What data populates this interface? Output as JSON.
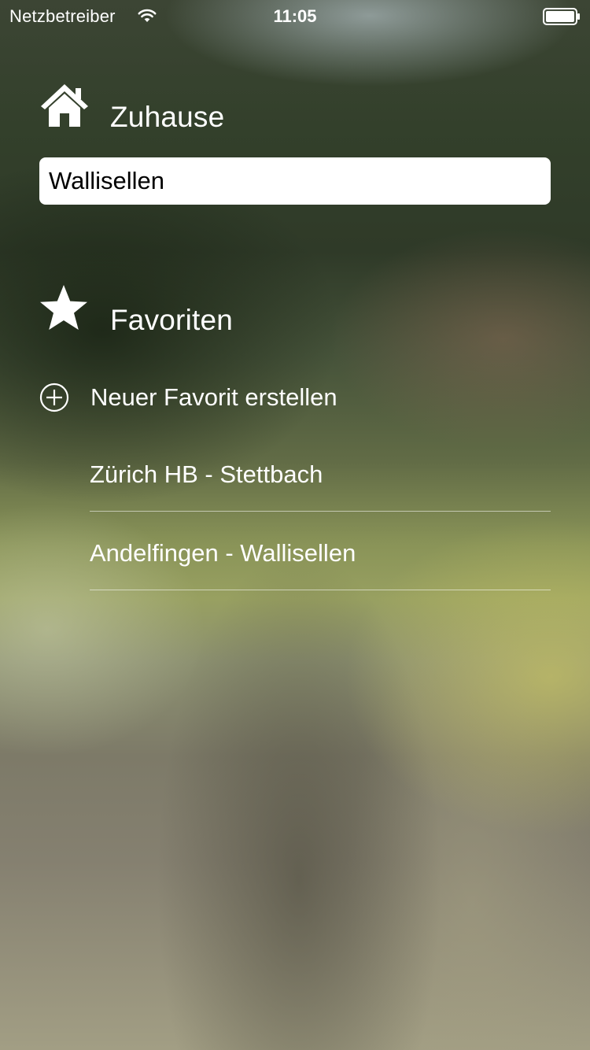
{
  "status_bar": {
    "carrier": "Netzbetreiber",
    "time": "11:05",
    "wifi_icon": "wifi-icon",
    "battery_icon": "battery-icon"
  },
  "home": {
    "icon": "house-icon",
    "title": "Zuhause",
    "field_value": "Wallisellen"
  },
  "favorites": {
    "icon": "star-icon",
    "title": "Favoriten",
    "add_icon": "plus-circle-icon",
    "add_label": "Neuer Favorit erstellen",
    "items": [
      {
        "label": "Zürich HB - Stettbach"
      },
      {
        "label": "Andelfingen - Wallisellen"
      }
    ]
  },
  "colors": {
    "text": "#ffffff",
    "field_background": "#ffffff",
    "field_text": "#000000"
  }
}
